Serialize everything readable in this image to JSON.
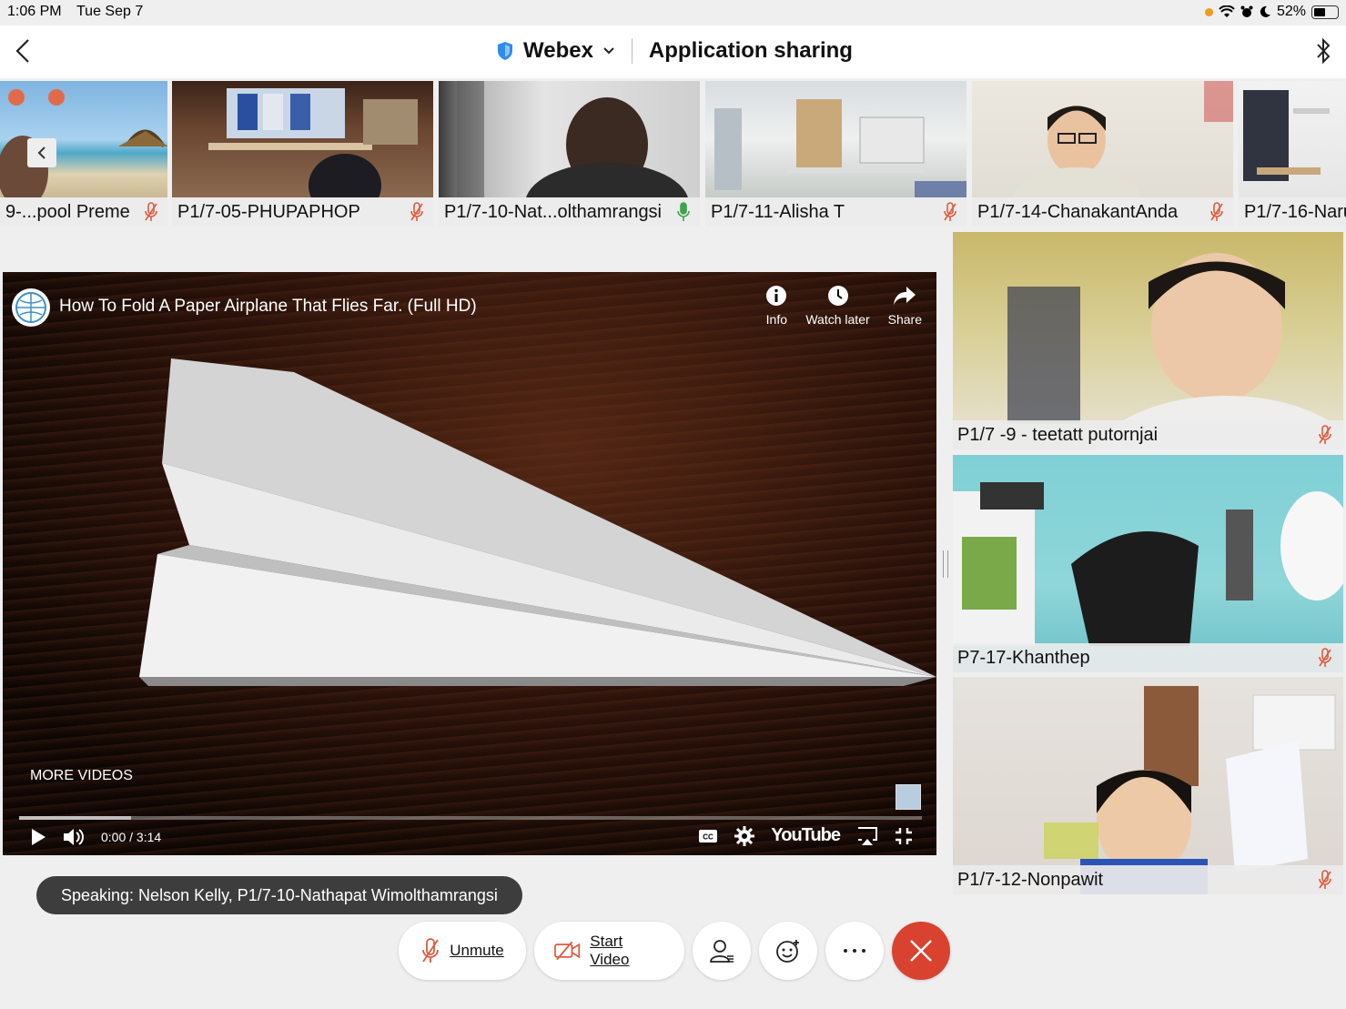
{
  "status_bar": {
    "time": "1:06 PM",
    "date": "Tue Sep 7",
    "battery": "52%"
  },
  "header": {
    "app_name": "Webex",
    "title": "Application sharing"
  },
  "thumbnails": [
    {
      "label": "9-...pool Preme"
    },
    {
      "label": "P1/7-05-PHUPAPHOP"
    },
    {
      "label": "P1/7-10-Nat...olthamrangsi"
    },
    {
      "label": "P1/7-11-Alisha T"
    },
    {
      "label": "P1/7-14-ChanakantAnda"
    },
    {
      "label": "P1/7-16-Naru"
    }
  ],
  "video": {
    "title": "How To Fold A Paper Airplane That Flies Far. (Full HD)",
    "actions": {
      "info": "Info",
      "watch_later": "Watch later",
      "share": "Share"
    },
    "more_videos": "MORE VIDEOS",
    "time": "0:00 / 3:14",
    "brand": "YouTube",
    "buffered": 0.124
  },
  "participants": [
    {
      "label": "P1/7 -9 - teetatt putornjai"
    },
    {
      "label": "P7-17-Khanthep"
    },
    {
      "label": "P1/7-12-Nonpawit"
    }
  ],
  "speaking": "Speaking: Nelson Kelly, P1/7-10-Nathapat Wimolthamrangsi",
  "toolbar": {
    "unmute": "Unmute",
    "start_video": "Start Video"
  },
  "colors": {
    "muted_mic": "#e05a3d",
    "active_mic": "#3fa34d",
    "end_call": "#d9422f",
    "webex_shield": "#2e8ee6"
  }
}
